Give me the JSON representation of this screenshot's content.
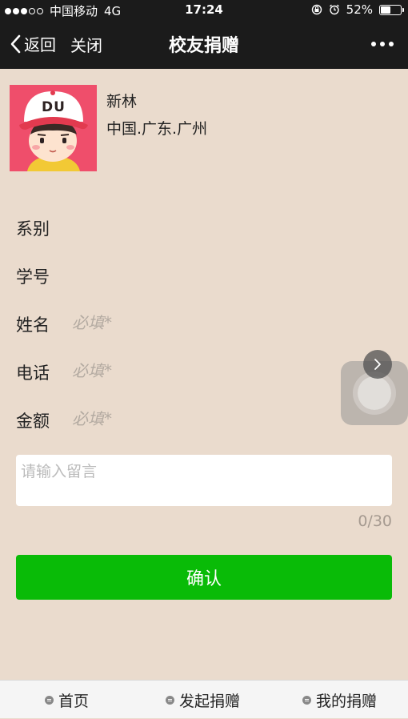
{
  "status_bar": {
    "carrier": "中国移动",
    "network": "4G",
    "time": "17:24",
    "battery_text": "52%",
    "battery_level": 0.52
  },
  "nav": {
    "back_label": "返回",
    "close_label": "关闭",
    "title": "校友捐赠"
  },
  "profile": {
    "name": "新林",
    "location": "中国.广东.广州",
    "avatar_logo_text": "DU"
  },
  "form": {
    "department_label": "系别",
    "student_id_label": "学号",
    "name_label": "姓名",
    "name_placeholder": "必填*",
    "phone_label": "电话",
    "phone_placeholder": "必填*",
    "amount_label": "金额",
    "amount_placeholder": "必填*",
    "message_placeholder": "请输入留言",
    "char_counter": "0/30",
    "confirm_label": "确认"
  },
  "tabbar": {
    "items": [
      {
        "label": "首页"
      },
      {
        "label": "发起捐赠"
      },
      {
        "label": "我的捐赠"
      }
    ]
  },
  "colors": {
    "accent_green": "#09bb07",
    "page_background": "#eadbcd",
    "header_background": "#1b1b1b"
  }
}
